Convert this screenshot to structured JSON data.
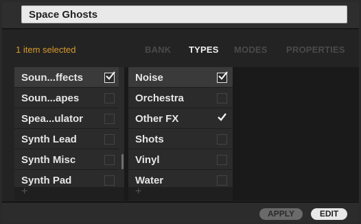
{
  "preset_name": "Space Ghosts",
  "header": {
    "selected_count": "1 item selected",
    "tabs": [
      {
        "label": "BANK",
        "active": false
      },
      {
        "label": "TYPES",
        "active": true
      },
      {
        "label": "MODES",
        "active": false
      },
      {
        "label": "PROPERTIES",
        "active": false
      }
    ]
  },
  "type_column": {
    "items": [
      {
        "label": "Soun...ffects",
        "checked": true
      },
      {
        "label": "Soun...apes",
        "checked": false
      },
      {
        "label": "Spea...ulator",
        "checked": false
      },
      {
        "label": "Synth Lead",
        "checked": false
      },
      {
        "label": "Synth Misc",
        "checked": false
      },
      {
        "label": "Synth Pad",
        "checked": false
      }
    ]
  },
  "subtype_column": {
    "items": [
      {
        "label": "Noise",
        "checked": true
      },
      {
        "label": "Orchestra",
        "checked": false
      },
      {
        "label": "Other FX",
        "checked": true
      },
      {
        "label": "Shots",
        "checked": false
      },
      {
        "label": "Vinyl",
        "checked": false
      },
      {
        "label": "Water",
        "checked": false
      }
    ]
  },
  "add_symbol": "+",
  "footer": {
    "apply_label": "APPLY",
    "edit_label": "EDIT"
  },
  "colors": {
    "accent_orange": "#d99a2b",
    "active_tab": "#f0f0f0",
    "inactive_tab": "#4a4a4a",
    "row_highlight": "#3a3a3a"
  }
}
